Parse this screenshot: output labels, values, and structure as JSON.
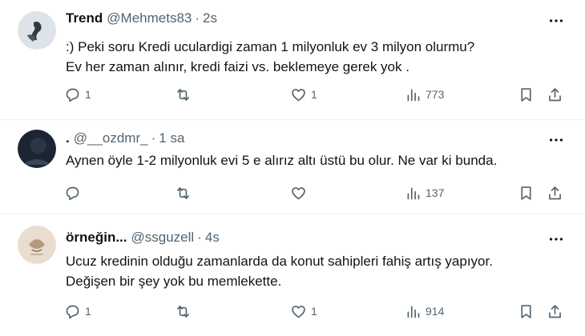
{
  "tweets": [
    {
      "display_name": "Trend",
      "handle": "@Mehmets83",
      "separator": "·",
      "time": "2s",
      "lines": [
        "·) Peki soru Kredi ucu​lardigi zaman 1 milyonluk ev 3 milyon olurmu?",
        "Ev her zaman alınır, kredi faizi vs. beklemeye gerek yok ."
      ],
      "replies": "1",
      "reposts": "",
      "likes": "1",
      "views": "773",
      "avatar_colors": [
        "#dde3e8",
        "#2f3b46"
      ]
    },
    {
      "display_name": ".",
      "handle": "@__ozdmr_",
      "separator": "·",
      "time": "1 sa",
      "lines": [
        "Aynen öyle 1-2 milyonluk evi 5 e alırız altı üstü bu olur. Ne var ki bunda."
      ],
      "replies": "",
      "reposts": "",
      "likes": "",
      "views": "137",
      "avatar_colors": [
        "#1c2533",
        "#3a4658"
      ]
    },
    {
      "display_name": "örneğin...",
      "handle": "@ssguzell",
      "separator": "·",
      "time": "4s",
      "lines": [
        "Ucuz kredinin olduğu zamanlarda da konut sahipleri fahiş artış yapıyor.",
        "Değişen bir şey yok bu memlekette."
      ],
      "replies": "1",
      "reposts": "",
      "likes": "1",
      "views": "914",
      "avatar_colors": [
        "#e9ddcf",
        "#8a6e55"
      ]
    }
  ],
  "icons": {
    "reply": "reply-icon",
    "repost": "repost-icon",
    "like": "like-icon",
    "views": "views-icon",
    "bookmark": "bookmark-icon",
    "share": "share-icon",
    "more": "more-icon"
  },
  "colors": {
    "text_primary": "#0f1419",
    "text_secondary": "#536471",
    "divider": "#eff3f4",
    "background": "#ffffff"
  }
}
